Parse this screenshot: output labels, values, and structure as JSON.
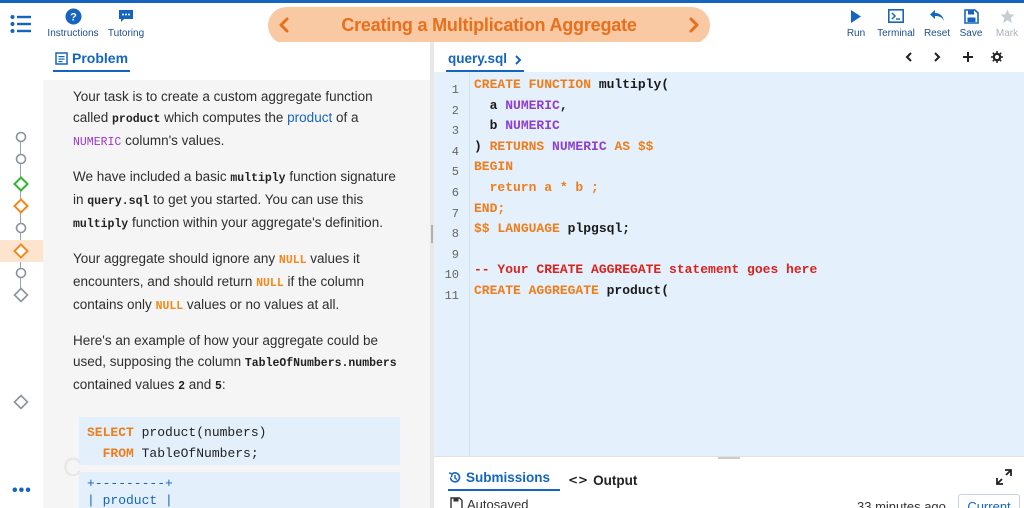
{
  "colors": {
    "accent": "#1565c0",
    "title_orange": "#e86f1c",
    "pill_bg": "#f9c9a3",
    "editor_bg": "#e4f0fb",
    "step_green": "#2eb82e",
    "step_orange": "#f08a1c"
  },
  "toolbar": {
    "instructions_label": "Instructions",
    "tutoring_label": "Tutoring",
    "run_label": "Run",
    "terminal_label": "Terminal",
    "reset_label": "Reset",
    "save_label": "Save",
    "mark_label": "Mark"
  },
  "title": "Creating a Multiplication Aggregate",
  "problem_tab": "Problem",
  "problem": {
    "p1_a": "Your task is to create a custom aggregate function called ",
    "p1_code": "product",
    "p1_b": " which computes the ",
    "p1_link": "product",
    "p1_c": " of a ",
    "p1_kw": "NUMERIC",
    "p1_d": " column's values.",
    "p2_a": "We have included a basic ",
    "p2_code1": "multiply",
    "p2_b": " function signature in ",
    "p2_code2": "query.sql",
    "p2_c": " to get you started. You can use this ",
    "p2_code3": "multiply",
    "p2_d": " function within your aggregate's definition.",
    "p3_a": "Your aggregate should ignore any ",
    "p3_null1": "NULL",
    "p3_b": " values it encounters, and should return ",
    "p3_null2": "NULL",
    "p3_c": " if the column contains only ",
    "p3_null3": "NULL",
    "p3_d": " values or no values at all.",
    "p4_a": "Here's an example of how your aggregate could be used, supposing the column ",
    "p4_code": "TableOfNumbers.numbers",
    "p4_b": " contained values ",
    "p4_v1": "2",
    "p4_c": " and ",
    "p4_v2": "5",
    "p4_d": ":",
    "sample_kw1": "SELECT",
    "sample_rest1": " product(numbers)",
    "sample_kw2": "FROM",
    "sample_rest2": " TableOfNumbers;",
    "sample2_line1": "+---------+",
    "sample2_line2": "| product |"
  },
  "editor": {
    "file_tab": "query.sql",
    "line_numbers": [
      "1",
      "2",
      "3",
      "4",
      "5",
      "6",
      "7",
      "8",
      "9",
      "10",
      "11"
    ]
  },
  "code": {
    "l1_kw": "CREATE FUNCTION",
    "l1_rest": " multiply(",
    "l2_name": "  a",
    "l2_type": "NUMERIC",
    "l2_end": ",",
    "l3_name": "  b",
    "l3_type": "NUMERIC",
    "l4_a": ") ",
    "l4_kw": "RETURNS",
    "l4_type": "NUMERIC",
    "l4_kw2": "AS",
    "l4_dollar": "$$",
    "l5_kw": "BEGIN",
    "l6_kw": "  return",
    "l6_expr": " a * b ;",
    "l7_kw": "END;",
    "l8_dollar": "$$",
    "l8_kw": "LANGUAGE",
    "l8_rest": " plpgsql;",
    "l10_comment": "-- Your CREATE AGGREGATE statement goes here",
    "l11_kw": "CREATE AGGREGATE",
    "l11_rest": " product("
  },
  "bottom": {
    "submissions_label": "Submissions",
    "output_label": "Output",
    "autosaved": "Autosaved",
    "time_ago": "33 minutes ago",
    "current_label": "Current"
  }
}
